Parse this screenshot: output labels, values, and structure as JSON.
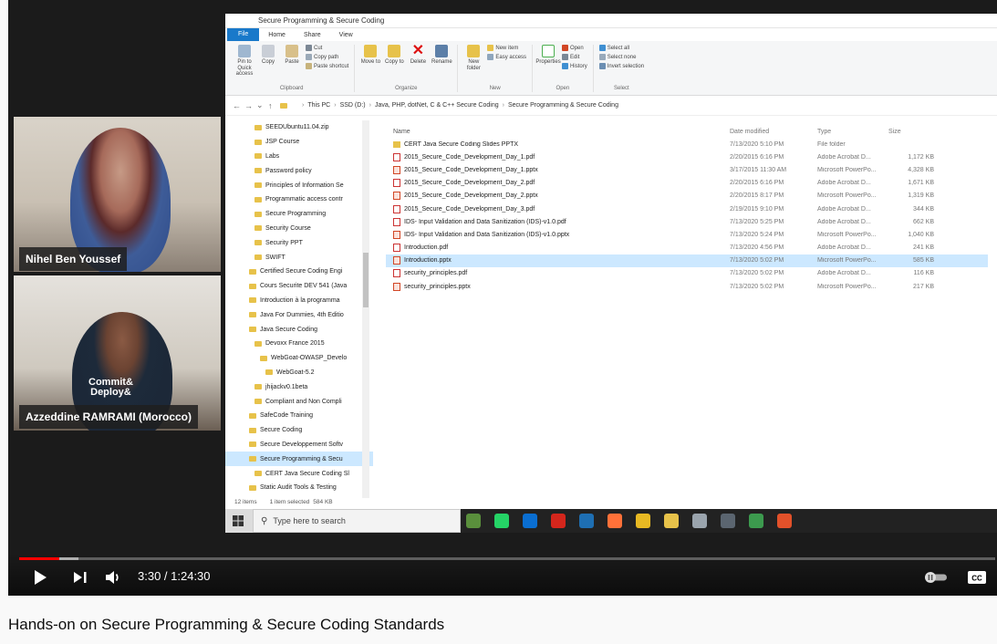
{
  "video": {
    "title": "Hands-on on Secure Programming & Secure Coding Standards",
    "time_display": "3:30 / 1:24:30",
    "progress_played": 0.041,
    "progress_loaded": 0.061,
    "accent_color": "#ff0000"
  },
  "participants": [
    {
      "name": "Nihel Ben Youssef"
    },
    {
      "name": "Azzeddine RAMRAMI (Morocco)"
    }
  ],
  "explorer": {
    "window_title": "Secure Programming & Secure Coding",
    "menu_tabs": [
      "File",
      "Home",
      "Share",
      "View"
    ],
    "ribbon": {
      "clipboard": {
        "label": "Clipboard",
        "pin": "Pin to Quick access",
        "copy": "Copy",
        "paste": "Paste",
        "cut": "Cut",
        "copy_path": "Copy path",
        "paste_shortcut": "Paste shortcut"
      },
      "organize": {
        "label": "Organize",
        "move_to": "Move to",
        "copy_to": "Copy to",
        "delete": "Delete",
        "rename": "Rename"
      },
      "new": {
        "label": "New",
        "new_folder": "New folder",
        "new_item": "New item",
        "easy_access": "Easy access"
      },
      "open": {
        "label": "Open",
        "properties": "Properties",
        "open": "Open",
        "edit": "Edit",
        "history": "History"
      },
      "select": {
        "label": "Select",
        "select_all": "Select all",
        "select_none": "Select none",
        "invert": "Invert selection"
      }
    },
    "breadcrumb": [
      "This PC",
      "SSD (D:)",
      "Java, PHP, dotNet, C & C++ Secure Coding",
      "Secure Programming & Secure Coding"
    ],
    "nav_items": [
      {
        "label": "SEEDUbuntu11.04.zip",
        "indent": 2
      },
      {
        "label": "JSP Course",
        "indent": 2
      },
      {
        "label": "Labs",
        "indent": 2
      },
      {
        "label": "Password policy",
        "indent": 2
      },
      {
        "label": "Principles of Information Se",
        "indent": 2
      },
      {
        "label": "Programmatic access contr",
        "indent": 2
      },
      {
        "label": "Secure Programming",
        "indent": 2
      },
      {
        "label": "Security Course",
        "indent": 2
      },
      {
        "label": "Security PPT",
        "indent": 2
      },
      {
        "label": "SWIFT",
        "indent": 2
      },
      {
        "label": "Certified Secure Coding Engi",
        "indent": 1
      },
      {
        "label": "Cours Securite DEV 541 (Java",
        "indent": 1
      },
      {
        "label": "Introduction à la programma",
        "indent": 1
      },
      {
        "label": "Java For Dummies, 4th Editio",
        "indent": 1
      },
      {
        "label": "Java Secure Coding",
        "indent": 1
      },
      {
        "label": "Devoxx France 2015",
        "indent": 2
      },
      {
        "label": "WebGoat-OWASP_Develo",
        "indent": 3
      },
      {
        "label": "WebGoat-5.2",
        "indent": 4
      },
      {
        "label": "jhijackv0.1beta",
        "indent": 2
      },
      {
        "label": "Compliant and Non Compli",
        "indent": 2
      },
      {
        "label": "SafeCode Training",
        "indent": 1
      },
      {
        "label": "Secure Coding",
        "indent": 1
      },
      {
        "label": "Secure Developpement Softv",
        "indent": 1
      },
      {
        "label": "Secure Programming & Secu",
        "indent": 1,
        "selected": true
      },
      {
        "label": "CERT Java Secure Coding Sl",
        "indent": 2
      },
      {
        "label": "Static Audit Tools & Testing",
        "indent": 1
      }
    ],
    "columns": {
      "name": "Name",
      "date": "Date modified",
      "type": "Type",
      "size": "Size"
    },
    "files": [
      {
        "name": "CERT Java Secure Coding Slides PPTX",
        "date": "7/13/2020 5:10 PM",
        "type": "File folder",
        "size": "",
        "icon": "folder"
      },
      {
        "name": "2015_Secure_Code_Development_Day_1.pdf",
        "date": "2/20/2015 6:16 PM",
        "type": "Adobe Acrobat D...",
        "size": "1,172 KB",
        "icon": "pdf"
      },
      {
        "name": "2015_Secure_Code_Development_Day_1.pptx",
        "date": "3/17/2015 11:30 AM",
        "type": "Microsoft PowerPo...",
        "size": "4,328 KB",
        "icon": "pptx"
      },
      {
        "name": "2015_Secure_Code_Development_Day_2.pdf",
        "date": "2/20/2015 6:16 PM",
        "type": "Adobe Acrobat D...",
        "size": "1,671 KB",
        "icon": "pdf"
      },
      {
        "name": "2015_Secure_Code_Development_Day_2.pptx",
        "date": "2/20/2015 8:17 PM",
        "type": "Microsoft PowerPo...",
        "size": "1,319 KB",
        "icon": "pptx"
      },
      {
        "name": "2015_Secure_Code_Development_Day_3.pdf",
        "date": "2/19/2015 9:10 PM",
        "type": "Adobe Acrobat D...",
        "size": "344 KB",
        "icon": "pdf"
      },
      {
        "name": "IDS- Input Validation and Data Sanitization (IDS)-v1.0.pdf",
        "date": "7/13/2020 5:25 PM",
        "type": "Adobe Acrobat D...",
        "size": "662 KB",
        "icon": "pdf"
      },
      {
        "name": "IDS- Input Validation and Data Sanitization (IDS)-v1.0.pptx",
        "date": "7/13/2020 5:24 PM",
        "type": "Microsoft PowerPo...",
        "size": "1,040 KB",
        "icon": "pptx"
      },
      {
        "name": "Introduction.pdf",
        "date": "7/13/2020 4:56 PM",
        "type": "Adobe Acrobat D...",
        "size": "241 KB",
        "icon": "pdf"
      },
      {
        "name": "Introduction.pptx",
        "date": "7/13/2020 5:02 PM",
        "type": "Microsoft PowerPo...",
        "size": "585 KB",
        "icon": "pptx",
        "selected": true
      },
      {
        "name": "security_principles.pdf",
        "date": "7/13/2020 5:02 PM",
        "type": "Adobe Acrobat D...",
        "size": "116 KB",
        "icon": "pdf"
      },
      {
        "name": "security_principles.pptx",
        "date": "7/13/2020 5:02 PM",
        "type": "Microsoft PowerPo...",
        "size": "217 KB",
        "icon": "pptx"
      }
    ],
    "status": {
      "items": "12 items",
      "selected": "1 item selected",
      "size": "584 KB"
    }
  },
  "taskbar": {
    "search_placeholder": "Type here to search",
    "apps": [
      {
        "icon": "mobaxterm-icon",
        "color": "#5a8f3c"
      },
      {
        "icon": "whatsapp-icon",
        "color": "#25d366"
      },
      {
        "icon": "edge-icon",
        "color": "#0a6ed1"
      },
      {
        "icon": "acrobat-icon",
        "color": "#d4261c"
      },
      {
        "icon": "virtualbox-icon",
        "color": "#1e6fb3"
      },
      {
        "icon": "firefox-icon",
        "color": "#ff7139"
      },
      {
        "icon": "chrome-icon",
        "color": "#e8b923"
      },
      {
        "icon": "file-explorer-icon",
        "color": "#e7c24a"
      },
      {
        "icon": "tool-icon",
        "color": "#9aa4ad"
      },
      {
        "icon": "terminal-icon",
        "color": "#5b6570"
      },
      {
        "icon": "network-icon",
        "color": "#3c9a4e"
      },
      {
        "icon": "app-icon",
        "color": "#e2512a"
      }
    ]
  }
}
